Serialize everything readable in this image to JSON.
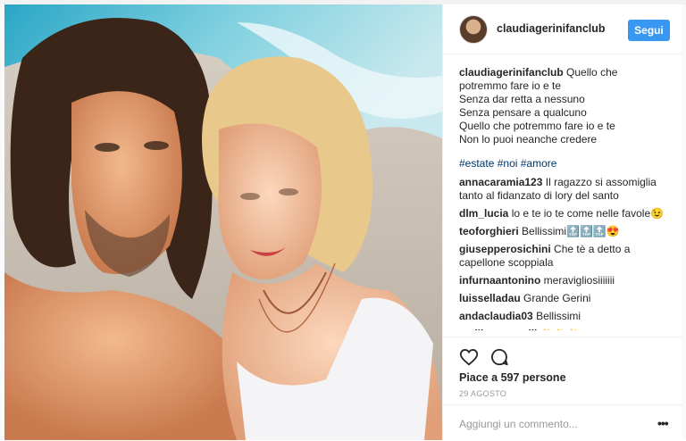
{
  "post": {
    "username": "claudiagerinifanclub",
    "follow_label": "Segui",
    "caption_lines": [
      "Quello che",
      "potremmo fare io e te",
      "Senza dar retta a nessuno",
      "Senza pensare a qualcuno",
      "Quello che potremmo fare io e te",
      "Non lo puoi neanche credere"
    ],
    "hashtags": [
      "#estate",
      "#noi",
      "#amore"
    ],
    "comments": [
      {
        "user": "annacaramia123",
        "text": "Il ragazzo si assomiglia tanto al fidanzato di lory del santo"
      },
      {
        "user": "dlm_lucia",
        "text": "lo e te io te come nelle favole😉"
      },
      {
        "user": "teoforghieri",
        "text": "Bellissimi🔝🔝🔝😍"
      },
      {
        "user": "giusepperosichini",
        "text": "Che tè a detto a capellone scoppiala"
      },
      {
        "user": "infurnaantonino",
        "text": "meravigliosiiiiiii"
      },
      {
        "user": "luisselladau",
        "text": "Grande Gerini"
      },
      {
        "user": "andaclaudia03",
        "text": "Bellissimi"
      },
      {
        "user": "emilianomarsili",
        "text": "✨✨✨"
      }
    ],
    "likes": "Piace a 597 persone",
    "date": "29 AGOSTO",
    "add_comment_placeholder": "Aggiungi un commento...",
    "more_label": "•••"
  },
  "icons": {
    "like": "heart-icon",
    "comment": "comment-bubble-icon",
    "more": "more-options-icon"
  },
  "colors": {
    "follow_button": "#3897f0",
    "hashtag": "#003569",
    "border": "#efefef"
  }
}
